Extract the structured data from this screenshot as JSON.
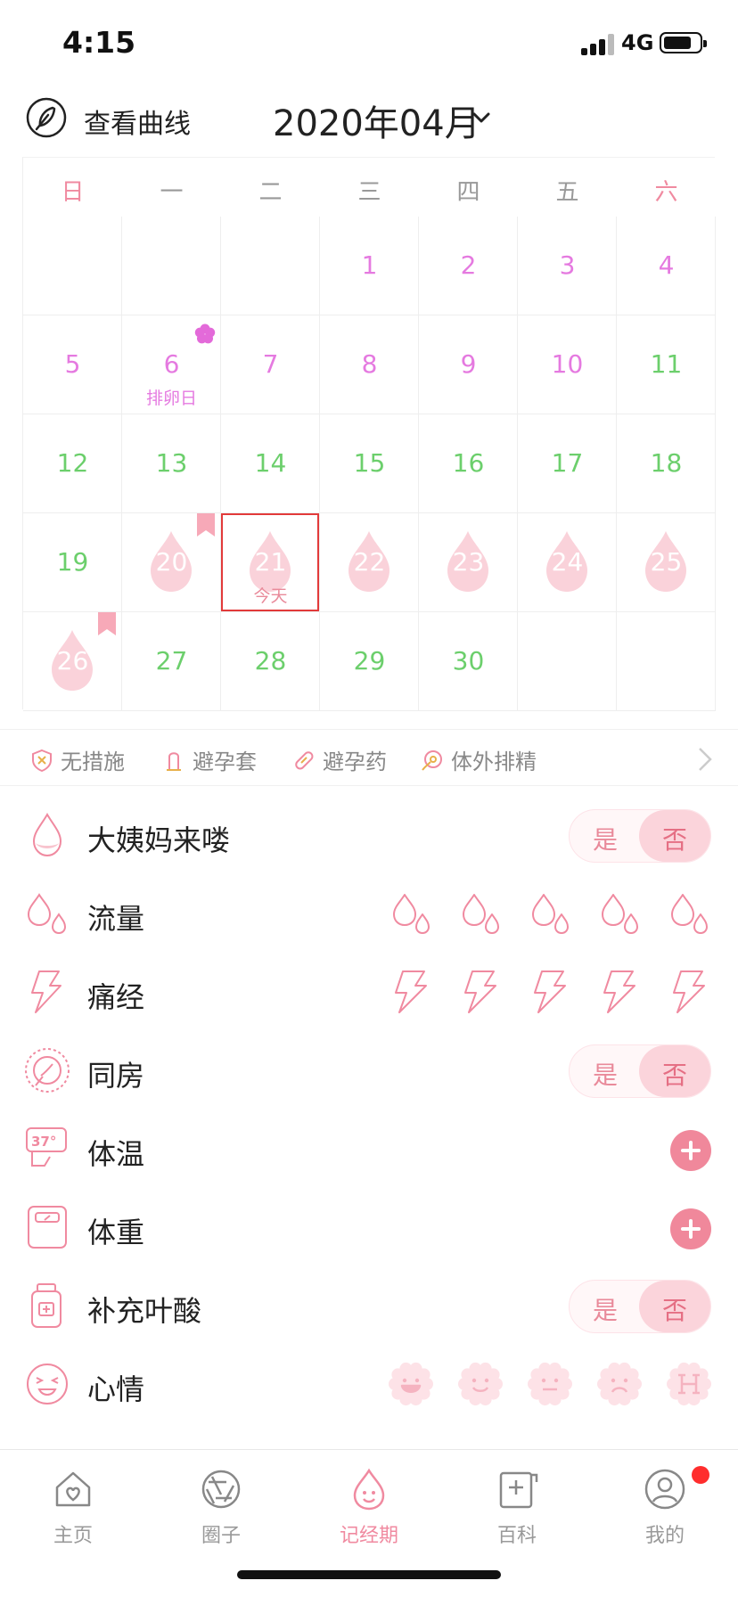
{
  "status": {
    "time": "4:15",
    "network": "4G"
  },
  "header": {
    "curve_label": "查看曲线",
    "month": "2020年04月"
  },
  "calendar": {
    "weekdays": [
      "日",
      "一",
      "二",
      "三",
      "四",
      "五",
      "六"
    ],
    "weekday_colors": [
      "#f08aa0",
      "#999999",
      "#999999",
      "#999999",
      "#999999",
      "#999999",
      "#f08aa0"
    ],
    "days": [
      {
        "d": "1",
        "col": 3,
        "row": 0,
        "color": "pink"
      },
      {
        "d": "2",
        "col": 4,
        "row": 0,
        "color": "pink"
      },
      {
        "d": "3",
        "col": 5,
        "row": 0,
        "color": "pink"
      },
      {
        "d": "4",
        "col": 6,
        "row": 0,
        "color": "pink"
      },
      {
        "d": "5",
        "col": 0,
        "row": 1,
        "color": "pink"
      },
      {
        "d": "6",
        "col": 1,
        "row": 1,
        "color": "pink",
        "sub": "排卵日",
        "flower": true
      },
      {
        "d": "7",
        "col": 2,
        "row": 1,
        "color": "pink"
      },
      {
        "d": "8",
        "col": 3,
        "row": 1,
        "color": "pink"
      },
      {
        "d": "9",
        "col": 4,
        "row": 1,
        "color": "pink"
      },
      {
        "d": "10",
        "col": 5,
        "row": 1,
        "color": "pink"
      },
      {
        "d": "11",
        "col": 6,
        "row": 1,
        "color": "green"
      },
      {
        "d": "12",
        "col": 0,
        "row": 2,
        "color": "green"
      },
      {
        "d": "13",
        "col": 1,
        "row": 2,
        "color": "green"
      },
      {
        "d": "14",
        "col": 2,
        "row": 2,
        "color": "green"
      },
      {
        "d": "15",
        "col": 3,
        "row": 2,
        "color": "green"
      },
      {
        "d": "16",
        "col": 4,
        "row": 2,
        "color": "green"
      },
      {
        "d": "17",
        "col": 5,
        "row": 2,
        "color": "green"
      },
      {
        "d": "18",
        "col": 6,
        "row": 2,
        "color": "green"
      },
      {
        "d": "19",
        "col": 0,
        "row": 3,
        "color": "green"
      },
      {
        "d": "20",
        "col": 1,
        "row": 3,
        "color": "period",
        "ribbon": true
      },
      {
        "d": "21",
        "col": 2,
        "row": 3,
        "color": "period",
        "sub": "今天",
        "today": true
      },
      {
        "d": "22",
        "col": 3,
        "row": 3,
        "color": "period"
      },
      {
        "d": "23",
        "col": 4,
        "row": 3,
        "color": "period"
      },
      {
        "d": "24",
        "col": 5,
        "row": 3,
        "color": "period"
      },
      {
        "d": "25",
        "col": 6,
        "row": 3,
        "color": "period"
      },
      {
        "d": "26",
        "col": 0,
        "row": 4,
        "color": "period",
        "ribbon": true
      },
      {
        "d": "27",
        "col": 1,
        "row": 4,
        "color": "green"
      },
      {
        "d": "28",
        "col": 2,
        "row": 4,
        "color": "green"
      },
      {
        "d": "29",
        "col": 3,
        "row": 4,
        "color": "green"
      },
      {
        "d": "30",
        "col": 4,
        "row": 4,
        "color": "green"
      }
    ]
  },
  "contraception": {
    "items": [
      {
        "label": "无措施",
        "icon": "shield-x-icon"
      },
      {
        "label": "避孕套",
        "icon": "condom-icon"
      },
      {
        "label": "避孕药",
        "icon": "pill-icon"
      },
      {
        "label": "体外排精",
        "icon": "sperm-icon"
      }
    ]
  },
  "records": {
    "period": {
      "label": "大姨妈来喽",
      "yes": "是",
      "no": "否"
    },
    "flow": {
      "label": "流量"
    },
    "pain": {
      "label": "痛经"
    },
    "sex": {
      "label": "同房",
      "yes": "是",
      "no": "否"
    },
    "temperature": {
      "label": "体温",
      "icon_text": "37°"
    },
    "weight": {
      "label": "体重"
    },
    "folic": {
      "label": "补充叶酸",
      "yes": "是",
      "no": "否"
    },
    "mood": {
      "label": "心情",
      "options": [
        "laugh-face-icon",
        "smile-face-icon",
        "neutral-face-icon",
        "sad-face-icon",
        "angry-face-icon"
      ]
    }
  },
  "tabs": [
    {
      "label": "主页",
      "icon": "home-heart-icon"
    },
    {
      "label": "圈子",
      "icon": "circle-lens-icon"
    },
    {
      "label": "记经期",
      "icon": "period-drop-icon",
      "active": true
    },
    {
      "label": "百科",
      "icon": "encyclopedia-icon"
    },
    {
      "label": "我的",
      "icon": "profile-icon",
      "badge": true
    }
  ],
  "colors": {
    "accent": "#f08aa0",
    "pink_day": "#e57ae0",
    "green_day": "#6ccf6c",
    "today_border": "#e23a3a"
  }
}
